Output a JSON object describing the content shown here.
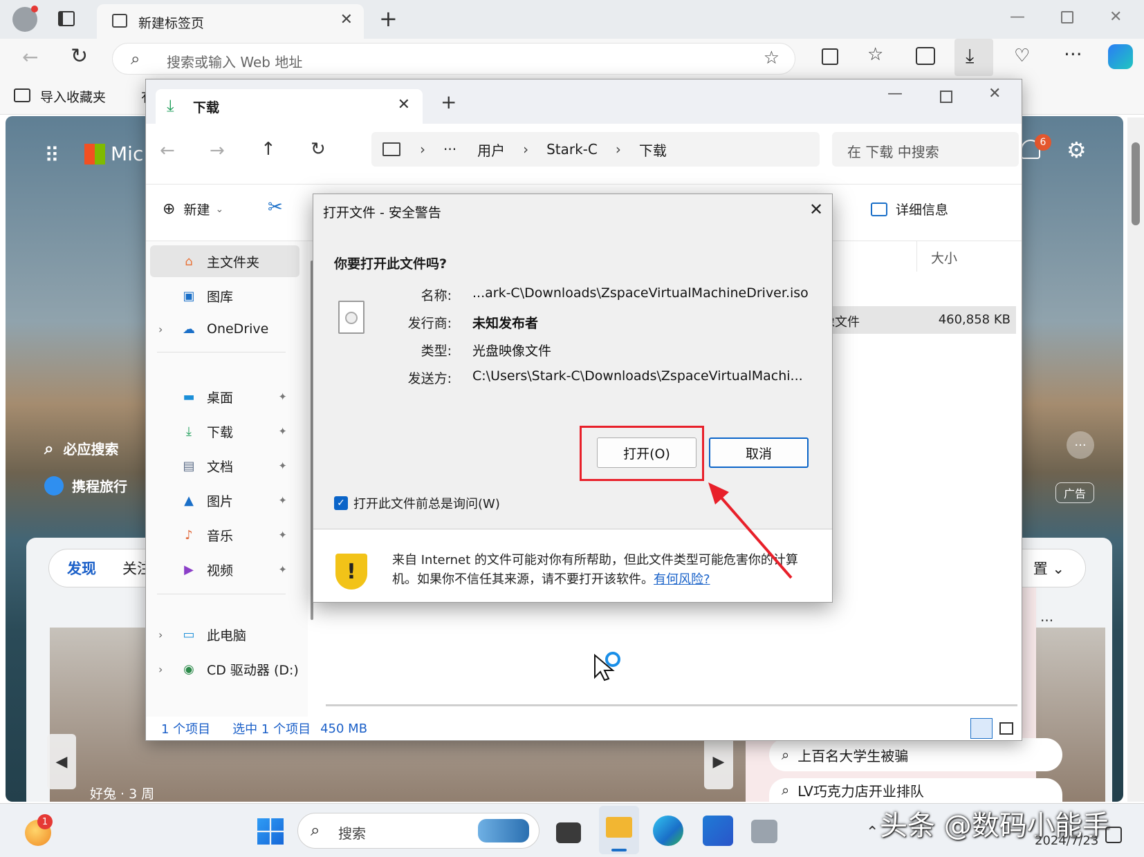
{
  "browser": {
    "tab_title": "新建标签页",
    "close_glyph": "✕",
    "new_tab_glyph": "+",
    "address_placeholder": "搜索或输入 Web 地址",
    "bookmark_import": "导入收藏夹",
    "bookmark_partial": "有"
  },
  "ntp": {
    "brand_partial": "Mic",
    "notif_count": "6",
    "shortcuts": [
      {
        "label": "必应搜索"
      },
      {
        "label": "携程旅行"
      }
    ],
    "feed_tabs": [
      {
        "label": "发现"
      },
      {
        "label": "关注"
      }
    ],
    "ad_label": "广告",
    "right_partial": "置",
    "card_caption": "好兔 · 3 周",
    "more_glyph": "···",
    "trending": [
      {
        "text": "上百名大学生被骗"
      },
      {
        "text": "LV巧克力店开业排队"
      }
    ]
  },
  "explorer": {
    "tab_title": "下载",
    "path": [
      {
        "label": "用户"
      },
      {
        "label": "Stark-C"
      },
      {
        "label": "下载"
      }
    ],
    "path_ellipsis": "···",
    "search_placeholder": "在 下载 中搜索",
    "cmd_new": "新建",
    "details_label": "详细信息",
    "column_size": "大小",
    "file_type_partial": "映像文件",
    "file_size": "460,858 KB",
    "sidebar": [
      {
        "label": "主文件夹",
        "icon": "home-icon",
        "selected": true
      },
      {
        "label": "图库",
        "icon": "gallery-icon"
      },
      {
        "label": "OneDrive",
        "icon": "cloud-icon"
      },
      {
        "label": "桌面",
        "icon": "desktop-icon"
      },
      {
        "label": "下载",
        "icon": "download-icon"
      },
      {
        "label": "文档",
        "icon": "document-icon"
      },
      {
        "label": "图片",
        "icon": "pictures-icon"
      },
      {
        "label": "音乐",
        "icon": "music-icon"
      },
      {
        "label": "视频",
        "icon": "video-icon"
      },
      {
        "label": "此电脑",
        "icon": "computer-icon"
      },
      {
        "label": "CD 驱动器 (D:)",
        "icon": "cd-drive-icon"
      }
    ],
    "status": {
      "items": "1 个项目",
      "selected": "选中 1 个项目",
      "size": "450 MB"
    }
  },
  "dialog": {
    "title": "打开文件 - 安全警告",
    "question": "你要打开此文件吗?",
    "fields": [
      {
        "label": "名称:",
        "value": "...ark-C\\Downloads\\ZspaceVirtualMachineDriver.iso"
      },
      {
        "label": "发行商:",
        "value": "未知发布者"
      },
      {
        "label": "类型:",
        "value": "光盘映像文件"
      },
      {
        "label": "发送方:",
        "value": "C:\\Users\\Stark-C\\Downloads\\ZspaceVirtualMachi..."
      }
    ],
    "open_button": "打开(O)",
    "cancel_button": "取消",
    "checkbox_label": "打开此文件前总是询问(W)",
    "checkbox_checked": true,
    "warning_text": "来自 Internet 的文件可能对你有所帮助，但此文件类型可能危害你的计算机。如果你不信任其来源，请不要打开该软件。",
    "warning_link": "有何风险?"
  },
  "taskbar": {
    "search_placeholder": "搜索",
    "badge_count": "1",
    "date": "2024/7/23",
    "watermark": "头条 @数码小能手"
  },
  "colors": {
    "accent": "#0a64c8",
    "highlight_box": "#e8202a",
    "link": "#1660c8",
    "warning_shield": "#f2c318"
  }
}
